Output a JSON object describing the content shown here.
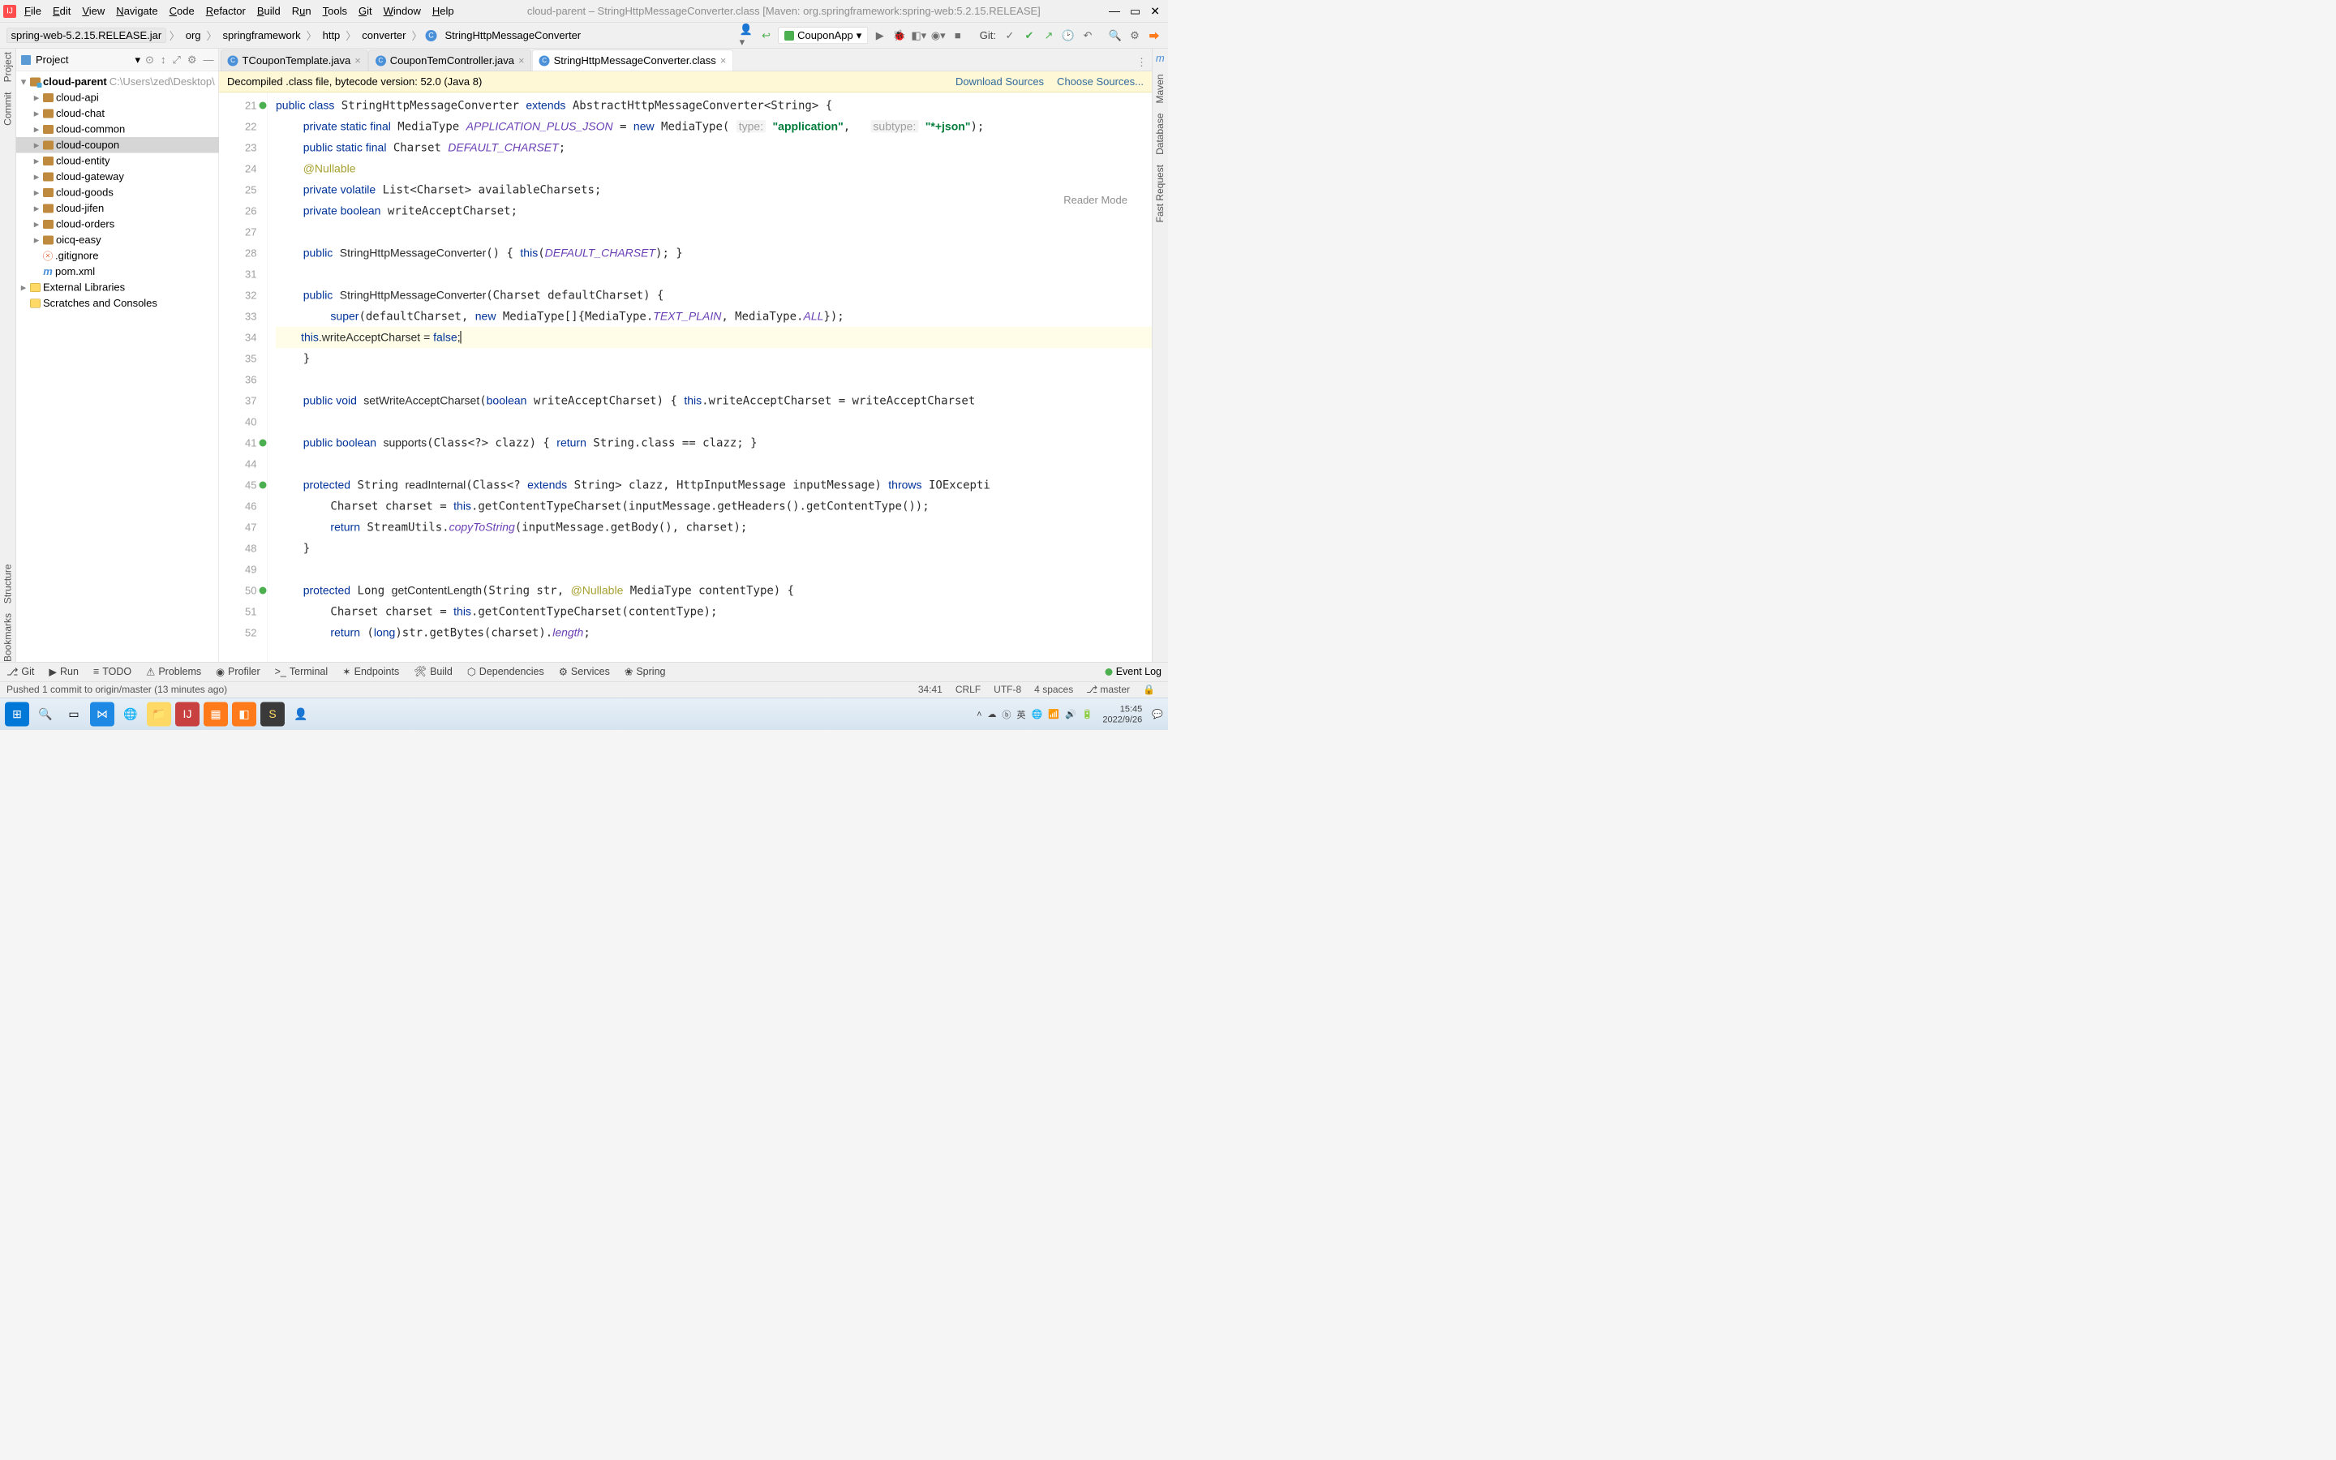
{
  "menu": [
    "File",
    "Edit",
    "View",
    "Navigate",
    "Code",
    "Refactor",
    "Build",
    "Run",
    "Tools",
    "Git",
    "Window",
    "Help"
  ],
  "title": "cloud-parent – StringHttpMessageConverter.class [Maven: org.springframework:spring-web:5.2.15.RELEASE]",
  "breadcrumb": {
    "jar": "spring-web-5.2.15.RELEASE.jar",
    "parts": [
      "org",
      "springframework",
      "http",
      "converter"
    ],
    "classIcon": "C",
    "className": "StringHttpMessageConverter"
  },
  "runConfig": "CouponApp",
  "vcsLabel": "Git:",
  "leftStrip": [
    "Project",
    "Commit"
  ],
  "rightStrip": [
    "m",
    "Maven",
    "Database",
    "Fast Request"
  ],
  "leftStripBottom": [
    "Structure",
    "Bookmarks"
  ],
  "projectHeader": {
    "title": "Project",
    "icons": [
      "⊙",
      "↕",
      "⤢",
      "⚙",
      "—"
    ]
  },
  "tree": [
    {
      "depth": 0,
      "arrow": "▾",
      "ico": "proj",
      "label": "cloud-parent",
      "suffix": "  C:\\Users\\zed\\Desktop\\",
      "bold": true
    },
    {
      "depth": 1,
      "arrow": "▸",
      "ico": "folder",
      "label": "cloud-api"
    },
    {
      "depth": 1,
      "arrow": "▸",
      "ico": "folder",
      "label": "cloud-chat"
    },
    {
      "depth": 1,
      "arrow": "▸",
      "ico": "folder",
      "label": "cloud-common"
    },
    {
      "depth": 1,
      "arrow": "▸",
      "ico": "folder",
      "label": "cloud-coupon",
      "sel": true
    },
    {
      "depth": 1,
      "arrow": "▸",
      "ico": "folder",
      "label": "cloud-entity"
    },
    {
      "depth": 1,
      "arrow": "▸",
      "ico": "folder",
      "label": "cloud-gateway"
    },
    {
      "depth": 1,
      "arrow": "▸",
      "ico": "folder",
      "label": "cloud-goods"
    },
    {
      "depth": 1,
      "arrow": "▸",
      "ico": "folder",
      "label": "cloud-jifen"
    },
    {
      "depth": 1,
      "arrow": "▸",
      "ico": "folder",
      "label": "cloud-orders"
    },
    {
      "depth": 1,
      "arrow": "▸",
      "ico": "folder",
      "label": "oicq-easy"
    },
    {
      "depth": 1,
      "arrow": "",
      "ico": "git",
      "label": ".gitignore"
    },
    {
      "depth": 1,
      "arrow": "",
      "ico": "m",
      "label": "pom.xml"
    },
    {
      "depth": 0,
      "arrow": "▸",
      "ico": "lib",
      "label": "External Libraries"
    },
    {
      "depth": 0,
      "arrow": "",
      "ico": "lib",
      "label": "Scratches and Consoles"
    }
  ],
  "tabs": [
    {
      "icon": "C",
      "label": "TCouponTemplate.java"
    },
    {
      "icon": "C",
      "label": "CouponTemController.java"
    },
    {
      "icon": "C",
      "label": "StringHttpMessageConverter.class",
      "active": true
    }
  ],
  "decompileBar": {
    "msg": "Decompiled .class file, bytecode version: 52.0 (Java 8)",
    "link1": "Download Sources",
    "link2": "Choose Sources..."
  },
  "readerMode": "Reader Mode",
  "gutter": [
    {
      "n": 21,
      "marker": "impl"
    },
    {
      "n": 22
    },
    {
      "n": 23
    },
    {
      "n": 24
    },
    {
      "n": 25
    },
    {
      "n": 26
    },
    {
      "n": 27
    },
    {
      "n": 28
    },
    {
      "n": 31
    },
    {
      "n": 32
    },
    {
      "n": 33
    },
    {
      "n": 34
    },
    {
      "n": 35
    },
    {
      "n": 36
    },
    {
      "n": 37
    },
    {
      "n": 40
    },
    {
      "n": 41,
      "marker": "override"
    },
    {
      "n": 44
    },
    {
      "n": 45,
      "marker": "override"
    },
    {
      "n": 46
    },
    {
      "n": 47
    },
    {
      "n": 48
    },
    {
      "n": 49
    },
    {
      "n": 50,
      "marker": "override"
    },
    {
      "n": 51
    },
    {
      "n": 52
    }
  ],
  "bottomTools": [
    {
      "ico": "⎇",
      "label": "Git"
    },
    {
      "ico": "▶",
      "label": "Run"
    },
    {
      "ico": "≡",
      "label": "TODO"
    },
    {
      "ico": "⚠",
      "label": "Problems"
    },
    {
      "ico": "◉",
      "label": "Profiler"
    },
    {
      "ico": ">_",
      "label": "Terminal"
    },
    {
      "ico": "✶",
      "label": "Endpoints"
    },
    {
      "ico": "🛠",
      "label": "Build"
    },
    {
      "ico": "⬡",
      "label": "Dependencies"
    },
    {
      "ico": "⚙",
      "label": "Services"
    },
    {
      "ico": "❀",
      "label": "Spring"
    }
  ],
  "eventLog": "Event Log",
  "statusbar": {
    "msg": "Pushed 1 commit to origin/master (13 minutes ago)",
    "pos": "34:41",
    "eol": "CRLF",
    "enc": "UTF-8",
    "indent": "4 spaces",
    "branch": "master"
  },
  "taskbar": {
    "time": "15:45",
    "date": "2022/9/26"
  }
}
